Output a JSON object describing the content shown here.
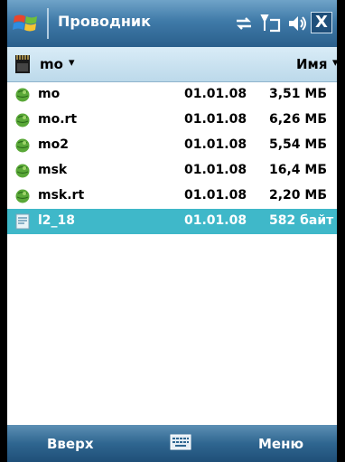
{
  "titlebar": {
    "title": "Проводник",
    "icons": [
      "windows-start-icon",
      "connectivity-icon",
      "signal-icon",
      "volume-icon",
      "close-icon"
    ],
    "close_label": "X"
  },
  "header": {
    "folder": "mo",
    "sort_label": "Имя",
    "caret": "▾"
  },
  "files": [
    {
      "name": "mo",
      "date": "01.01.08",
      "size": "3,51 МБ",
      "icon": "map-globe-icon",
      "selected": false
    },
    {
      "name": "mo.rt",
      "date": "01.01.08",
      "size": "6,26 МБ",
      "icon": "map-globe-icon",
      "selected": false
    },
    {
      "name": "mo2",
      "date": "01.01.08",
      "size": "5,54 МБ",
      "icon": "map-globe-icon",
      "selected": false
    },
    {
      "name": "msk",
      "date": "01.01.08",
      "size": "16,4 МБ",
      "icon": "map-globe-icon",
      "selected": false
    },
    {
      "name": "msk.rt",
      "date": "01.01.08",
      "size": "2,20 МБ",
      "icon": "map-globe-icon",
      "selected": false
    },
    {
      "name": "l2_18",
      "date": "01.01.08",
      "size": "582 байт",
      "icon": "file-icon",
      "selected": true
    }
  ],
  "softkeys": {
    "left": "Вверх",
    "right": "Меню"
  },
  "colors": {
    "selection": "#3fb8c9",
    "titlebar": "#3f7aa8",
    "header": "#cfe5f3"
  }
}
